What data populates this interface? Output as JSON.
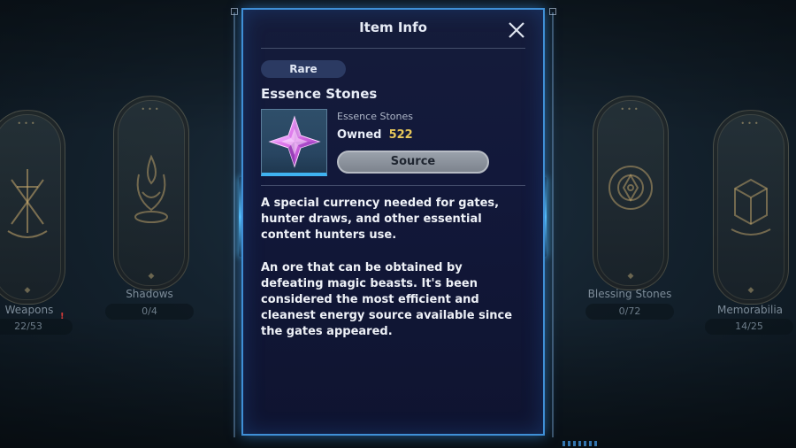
{
  "background_categories": [
    {
      "label": "Weapons",
      "count": "22/53",
      "alert": "!",
      "icon": "sword-emblem-icon"
    },
    {
      "label": "Shadows",
      "count": "0/4",
      "icon": "shadow-flame-emblem-icon"
    },
    {
      "label": "Blessing Stones",
      "count": "0/72",
      "icon": "blessing-stone-emblem-icon"
    },
    {
      "label": "Memorabilia",
      "count": "14/25",
      "icon": "memorabilia-box-emblem-icon"
    }
  ],
  "modal": {
    "title": "Item Info",
    "close_icon": "close-icon",
    "rarity": "Rare",
    "item_name": "Essence Stones",
    "item_subname": "Essence Stones",
    "owned_label": "Owned",
    "owned_value": "522",
    "source_label": "Source",
    "item_icon": "essence-stone-crystal-icon",
    "description_1": "A special currency needed for gates, hunter draws, and other essential content hunters use.",
    "description_2": "An ore that can be obtained by defeating magic beasts. It's been considered the most efficient and cleanest energy source available since the gates appeared."
  },
  "colors": {
    "accent_blue": "#3f8fd6",
    "owned_value_gold": "#e7c75a",
    "crystal_pink": "#d86be6"
  }
}
